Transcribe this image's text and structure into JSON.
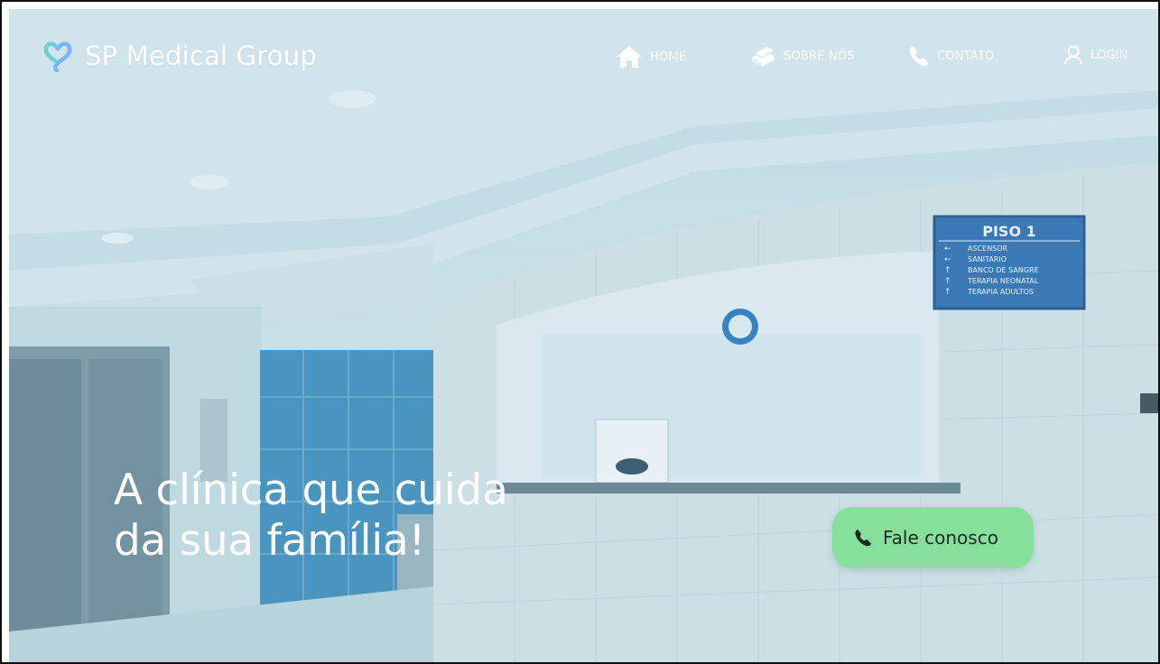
{
  "brand": {
    "name": "SP Medical Group",
    "logo_icon": "heart-logo-icon",
    "logo_colors": [
      "#6ccfd8",
      "#7ab6ff"
    ]
  },
  "nav": {
    "items": [
      {
        "label": "HOME",
        "icon": "home-icon"
      },
      {
        "label": "SOBRE NÓS",
        "icon": "books-icon"
      },
      {
        "label": "CONTATO",
        "icon": "phone-icon"
      },
      {
        "label": "LOGIN",
        "icon": "user-icon"
      }
    ]
  },
  "hero": {
    "headline_line1": "A clínica que cuida",
    "headline_line2": "da sua família!",
    "cta_label": "Fale conosco",
    "cta_icon": "phone-icon",
    "cta_color": "#86df9a"
  },
  "sign": {
    "title": "PISO 1",
    "lines": [
      "ASCENSOR",
      "SANITARIO",
      "BANCO DE SANGRE",
      "TERAPIA NEONATAL",
      "TERAPIA ADULTOS"
    ]
  }
}
